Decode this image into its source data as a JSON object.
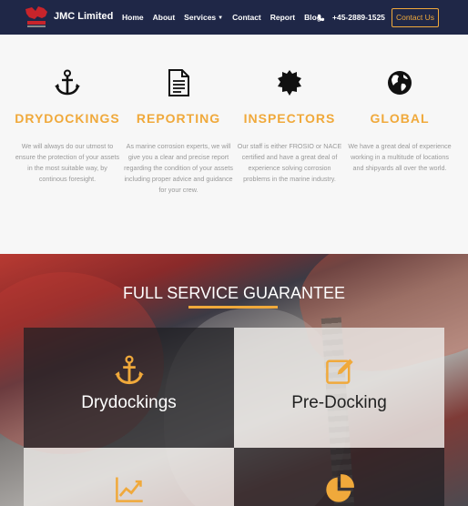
{
  "navbar": {
    "brand": "JMC Limited",
    "items": [
      {
        "label": "Home"
      },
      {
        "label": "About"
      },
      {
        "label": "Services",
        "has_dropdown": true
      },
      {
        "label": "Contact"
      },
      {
        "label": "Report"
      },
      {
        "label": "Blog"
      }
    ],
    "phone": "+45-2889-1525",
    "contact_button": "Contact Us"
  },
  "features": [
    {
      "icon": "anchor-icon",
      "title": "DRYDOCKINGS",
      "text": "We will always do our utmost to ensure the protection of your assets in the most suitable way, by continous foresight."
    },
    {
      "icon": "document-icon",
      "title": "REPORTING",
      "text": "As marine corrosion experts, we will give you a clear and precise report regarding the condition of your assets including proper advice and guidance for your crew."
    },
    {
      "icon": "badge-icon",
      "title": "INSPECTORS",
      "text": "Our staff is either FROSIO or NACE certified and have a great deal of experience solving corrosion problems in the marine industry."
    },
    {
      "icon": "globe-icon",
      "title": "GLOBAL",
      "text": "We have a great deal of experience working in a multitude of locations and shipyards all over the world."
    }
  ],
  "hero": {
    "title": "FULL SERVICE GUARANTEE",
    "services": [
      {
        "label": "Drydockings",
        "icon": "anchor-icon"
      },
      {
        "label": "Pre-Docking",
        "icon": "edit-icon"
      },
      {
        "label": "",
        "icon": "line-chart-icon"
      },
      {
        "label": "",
        "icon": "pie-chart-icon"
      }
    ]
  },
  "colors": {
    "navbar_bg": "#1f2747",
    "accent": "#f0a93b",
    "feature_text": "#999999"
  }
}
